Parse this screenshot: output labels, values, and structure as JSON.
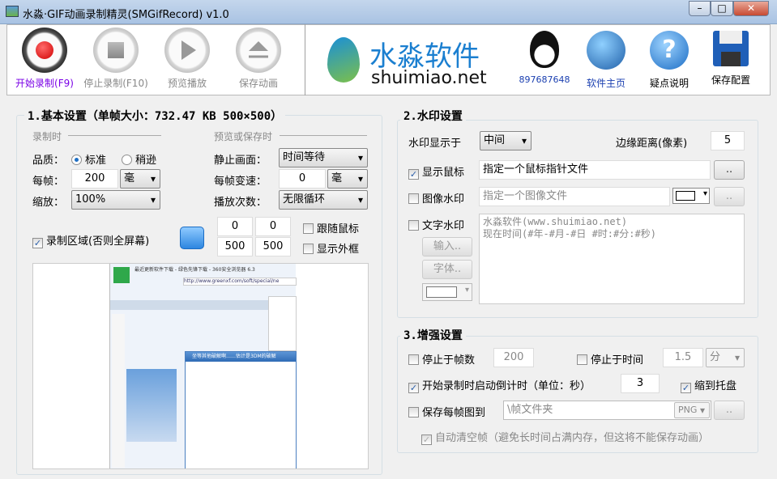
{
  "window": {
    "title": "水淼·GIF动画录制精灵(SMGifRecord) v1.0",
    "minimize": "–",
    "maximize": "□",
    "close": "✕"
  },
  "toolbar": {
    "start": "开始录制(F9)",
    "stop": "停止录制(F10)",
    "preview": "预览播放",
    "save": "保存动画",
    "qq": "897687648",
    "homepage": "软件主页",
    "help": "疑点说明",
    "save_config": "保存配置"
  },
  "logo": {
    "cn": "水淼软件",
    "en": "shuimiao.net"
  },
  "basic": {
    "title": "1.基本设置（单帧大小：732.47 KB 500×500）",
    "recording_heading": "录制时",
    "quality_label": "品质：",
    "quality_standard": "标准",
    "quality_low": "稍逊",
    "per_frame_label": "每帧：",
    "per_frame_value": "200",
    "per_frame_unit": "毫",
    "scale_label": "缩放：",
    "scale_value": "100%",
    "preview_heading": "预览或保存时",
    "still_label": "静止画面：",
    "still_value": "时间等待",
    "speed_label": "每帧变速：",
    "speed_value": "0",
    "speed_unit": "毫",
    "loops_label": "播放次数：",
    "loops_value": "无限循环",
    "region_label": "录制区域(否则全屏幕)",
    "x": "0",
    "y": "0",
    "w": "500",
    "h": "500",
    "follow_mouse": "跟随鼠标",
    "show_frame": "显示外框"
  },
  "preview_image": {
    "tab": "最近更新软件下载 - 绿色先锋下载 - 360安全浏览器 6.3",
    "url": "http://www.greenxf.com/soft/special/ne",
    "popup_title": "坐等其他破解啊……估计是3DM的破解"
  },
  "watermark": {
    "title": "2.水印设置",
    "position_label": "水印显示于",
    "position_value": "中间",
    "margin_label": "边缘距离(像素)",
    "margin_value": "5",
    "show_cursor": "显示鼠标",
    "cursor_file": "指定一个鼠标指针文件",
    "image_wm": "图像水印",
    "image_file": "指定一个图像文件",
    "text_wm": "文字水印",
    "text_value": "水淼软件(www.shuimiao.net)\n现在时间(#年-#月-#日 #时:#分:#秒)",
    "input_btn": "输入..",
    "font_btn": "字体..",
    "browse": ".."
  },
  "enhance": {
    "title": "3.增强设置",
    "stop_frames": "停止于帧数",
    "stop_frames_value": "200",
    "stop_time": "停止于时间",
    "stop_time_value": "1.5",
    "stop_time_unit": "分",
    "countdown": "开始录制时启动倒计时（单位：秒）",
    "countdown_value": "3",
    "tray": "缩到托盘",
    "save_frames": "保存每帧图到",
    "frames_folder": "\\帧文件夹",
    "format": "PNG",
    "browse": "..",
    "auto_clear": "自动清空帧（避免长时间占满内存，但这将不能保存动画）"
  }
}
